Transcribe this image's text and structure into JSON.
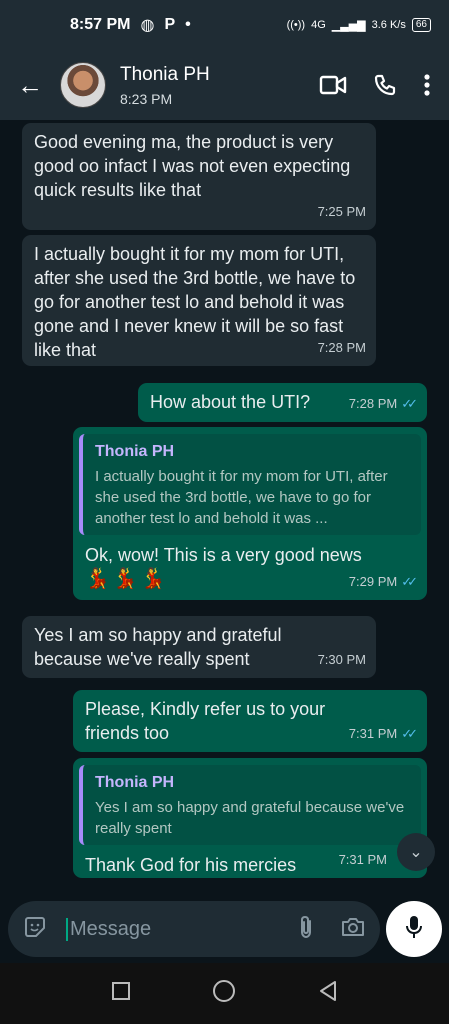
{
  "status_bar": {
    "time": "8:57 PM",
    "icons": [
      "hotspot-icon",
      "p-icon",
      "dot-icon"
    ],
    "network": "4G",
    "speed": "3.6 K/s",
    "battery": "66"
  },
  "header": {
    "contact_name": "Thonia PH",
    "subtitle": "8:23 PM"
  },
  "messages": [
    {
      "dir": "in",
      "text": "Good  evening ma, the product is very good oo infact I was not even expecting quick results like that",
      "time": "7:25 PM"
    },
    {
      "dir": "in",
      "text": "I actually bought it for my mom for UTI, after she used the 3rd bottle, we have to go for another test lo and behold it was gone and I never knew it will be so fast like that",
      "time": "7:28 PM"
    },
    {
      "dir": "out",
      "text": "How about the UTI?",
      "time": "7:28 PM"
    },
    {
      "dir": "out",
      "quote_name": "Thonia PH",
      "quote_text": "I actually bought it for my mom for UTI, after she used the 3rd bottle, we have to go for another test lo and behold it was ...",
      "text": "Ok, wow! This is a very good news",
      "emoji": "💃💃💃",
      "time": "7:29 PM"
    },
    {
      "dir": "in",
      "text": "Yes I am so happy and grateful because we've really spent",
      "time": "7:30 PM"
    },
    {
      "dir": "out",
      "text": "Please, Kindly refer us to your friends too",
      "time": "7:31 PM"
    },
    {
      "dir": "out",
      "quote_name": "Thonia PH",
      "quote_text": "Yes I am so happy and grateful because we've really spent",
      "text": "Thank God for his mercies",
      "time": "7:31 PM"
    }
  ],
  "composer": {
    "placeholder": "Message"
  },
  "colors": {
    "incoming_bubble": "#202c33",
    "outgoing_bubble": "#005c4b",
    "read_ticks": "#53bdeb",
    "quote_bar": "#a78bfa"
  }
}
